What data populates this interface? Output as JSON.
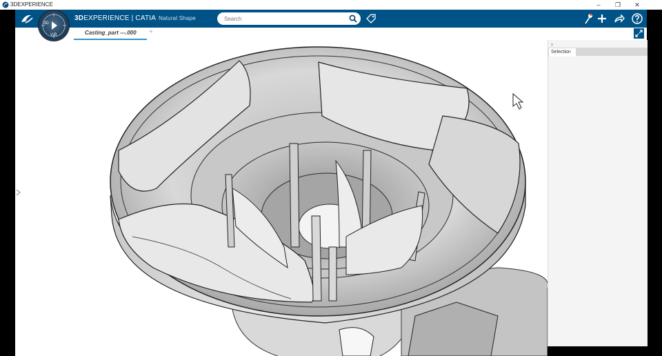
{
  "window": {
    "title": "3DEXPERIENCE",
    "controls": {
      "minimize": "–",
      "restore": "❐",
      "close": "✕"
    }
  },
  "topbar": {
    "brand_bold": "3D",
    "brand_main": "EXPERIENCE | CATIA",
    "brand_sub": "Natural Shape",
    "compass": {
      "top_label": "3D",
      "bottom_label": "V,R"
    },
    "search": {
      "placeholder": "Search"
    },
    "icons": [
      "ds-logo-icon",
      "search-icon",
      "tag-icon",
      "user-icon",
      "add-icon",
      "share-icon",
      "help-icon"
    ]
  },
  "tabs": [
    {
      "label": "Casting_part ---.000",
      "active": true
    }
  ],
  "tab_add": "+",
  "panel": {
    "chevron": "›",
    "tab_label": "Selection"
  },
  "colors": {
    "topbar_bg": "#005386",
    "tab_accent": "#368ec4",
    "viewport_bg": "#ffffff"
  }
}
